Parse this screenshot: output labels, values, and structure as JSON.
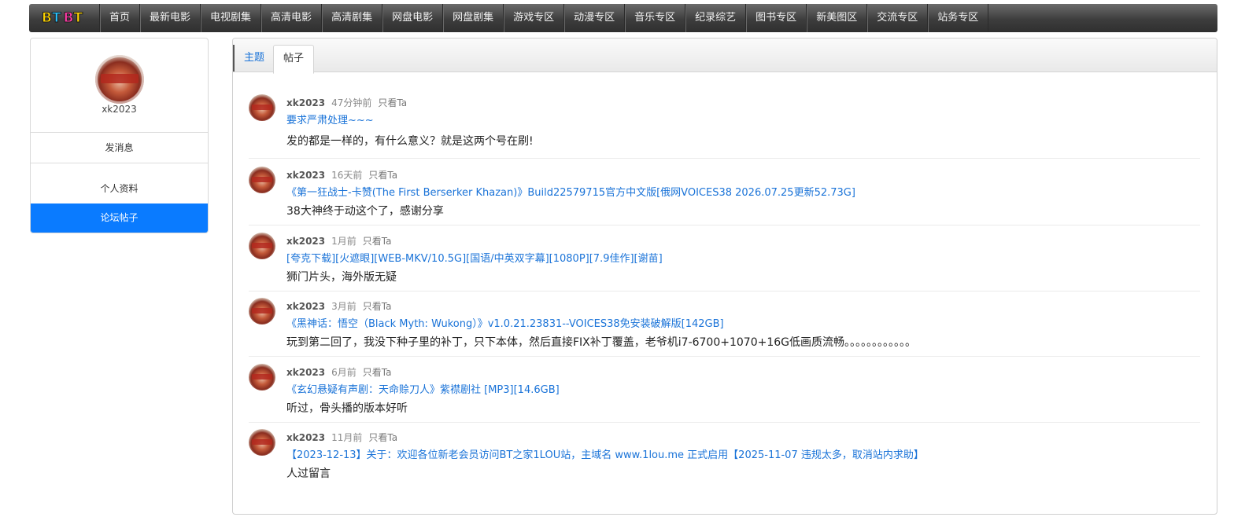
{
  "nav": {
    "logo_letters": [
      "B",
      "T",
      "B",
      "T"
    ],
    "items": [
      "首页",
      "最新电影",
      "电视剧集",
      "高清电影",
      "高清剧集",
      "网盘电影",
      "网盘剧集",
      "游戏专区",
      "动漫专区",
      "音乐专区",
      "纪录综艺",
      "图书专区",
      "新美图区",
      "交流专区",
      "站务专区"
    ]
  },
  "sidebar": {
    "username": "xk2023",
    "send_message": "发消息",
    "profile": "个人资料",
    "forum_posts": "论坛帖子"
  },
  "tabs": {
    "topics": "主题",
    "posts": "帖子"
  },
  "colors": {
    "accent": "#0a7bff",
    "link": "#1a73d8"
  },
  "posts": [
    {
      "user": "xk2023",
      "time": "47分钟前",
      "only": "只看Ta",
      "title": "要求严肃处理~~~",
      "body": "发的都是一样的，有什么意义？就是这两个号在刷!"
    },
    {
      "user": "xk2023",
      "time": "16天前",
      "only": "只看Ta",
      "title": "《第一狂战士-卡赞(The First Berserker Khazan)》Build22579715官方中文版[俄网VOICES38 2026.07.25更新52.73G]",
      "body": "38大神终于动这个了，感谢分享"
    },
    {
      "user": "xk2023",
      "time": "1月前",
      "only": "只看Ta",
      "title": "[夸克下载][火遮眼][WEB-MKV/10.5G][国语/中英双字幕][1080P][7.9佳作][谢苗]",
      "body": "狮门片头，海外版无疑"
    },
    {
      "user": "xk2023",
      "time": "3月前",
      "only": "只看Ta",
      "title": "《黑神话：悟空（Black Myth: Wukong）》v1.0.21.23831--VOICES38免安装破解版[142GB]",
      "body": "玩到第二回了，我没下种子里的补丁，只下本体，然后直接FIX补丁覆盖，老爷机i7-6700+1070+16G低画质流畅。。。。。。。。。。。。"
    },
    {
      "user": "xk2023",
      "time": "6月前",
      "only": "只看Ta",
      "title": "《玄幻悬疑有声剧：天命赊刀人》紫襟剧社 [MP3][14.6GB]",
      "body": "听过，骨头播的版本好听"
    },
    {
      "user": "xk2023",
      "time": "11月前",
      "only": "只看Ta",
      "title": "【2023-12-13】关于：欢迎各位新老会员访问BT之家1LOU站，主域名 www.1lou.me 正式启用【2025-11-07 违规太多，取消站内求助】",
      "body": "人过留言"
    }
  ]
}
